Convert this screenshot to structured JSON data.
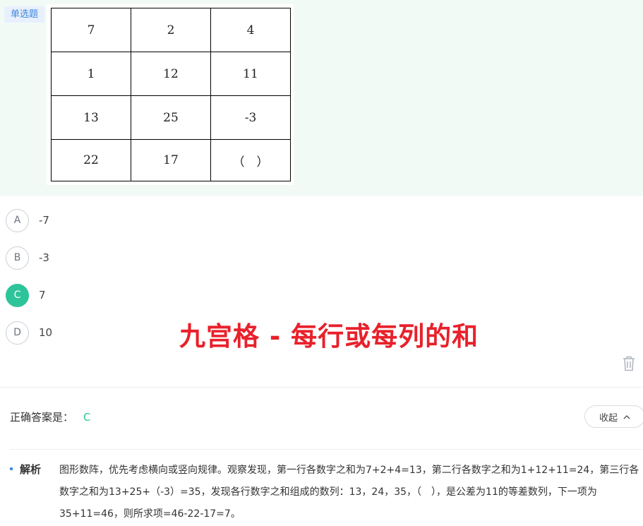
{
  "question": {
    "type_tag": "单选题",
    "grid": [
      [
        "7",
        "2",
        "4"
      ],
      [
        "1",
        "12",
        "11"
      ],
      [
        "13",
        "25",
        "-3"
      ],
      [
        "22",
        "17",
        "（　）"
      ]
    ]
  },
  "options": [
    {
      "letter": "A",
      "text": "-7",
      "selected": false
    },
    {
      "letter": "B",
      "text": "-3",
      "selected": false
    },
    {
      "letter": "C",
      "text": "7",
      "selected": true
    },
    {
      "letter": "D",
      "text": "10",
      "selected": false
    }
  ],
  "overlay_title": "九宫格 - 每行或每列的和",
  "icons": {
    "delete": "trash-icon",
    "collapse": "chevron-up-icon"
  },
  "colors": {
    "accent_green": "#2ec49a",
    "tag_blue": "#3f86e0",
    "overlay_red": "#e8212b"
  },
  "answer": {
    "label": "正确答案是：",
    "value": "C"
  },
  "collapse_button": "收起",
  "analysis": {
    "label": "解析",
    "text": "图形数阵，优先考虑横向或竖向规律。观察发现，第一行各数字之和为7+2+4=13，第二行各数字之和为1+12+11=24，第三行各数字之和为13+25+（-3）=35，发现各行数字之和组成的数列：13，24，35，（　），是公差为11的等差数列，下一项为35+11=46，则所求项=46-22-17=7。"
  }
}
